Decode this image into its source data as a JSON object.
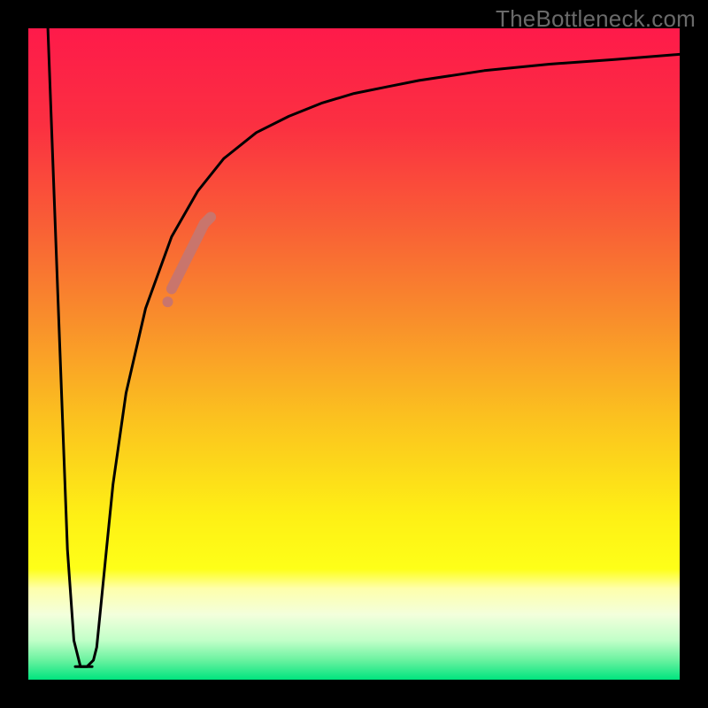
{
  "watermark": "TheBottleneck.com",
  "chart_data": {
    "type": "line",
    "title": "",
    "xlabel": "",
    "ylabel": "",
    "xlim": [
      0,
      100
    ],
    "ylim": [
      0,
      100
    ],
    "background_gradient": {
      "type": "vertical",
      "stops": [
        {
          "pos": 0.0,
          "color": "#fe1a4a"
        },
        {
          "pos": 0.15,
          "color": "#fb3041"
        },
        {
          "pos": 0.3,
          "color": "#f95e36"
        },
        {
          "pos": 0.45,
          "color": "#f98f2b"
        },
        {
          "pos": 0.6,
          "color": "#fbc21f"
        },
        {
          "pos": 0.75,
          "color": "#fef015"
        },
        {
          "pos": 0.83,
          "color": "#feff18"
        },
        {
          "pos": 0.86,
          "color": "#feffab"
        },
        {
          "pos": 0.9,
          "color": "#f3ffdc"
        },
        {
          "pos": 0.94,
          "color": "#c1ffc8"
        },
        {
          "pos": 0.97,
          "color": "#6af2a0"
        },
        {
          "pos": 1.0,
          "color": "#00e47e"
        }
      ]
    },
    "series": [
      {
        "name": "curve",
        "color": "#000000",
        "x": [
          3,
          4.5,
          6,
          7,
          8,
          9,
          10,
          10.5,
          11,
          12,
          13,
          15,
          18,
          22,
          26,
          30,
          35,
          40,
          45,
          50,
          55,
          60,
          70,
          80,
          90,
          100
        ],
        "y": [
          100,
          60,
          20,
          6,
          2,
          2,
          3,
          5,
          10,
          20,
          30,
          44,
          57,
          68,
          75,
          80,
          84,
          86.5,
          88.5,
          90,
          91,
          92,
          93.5,
          94.5,
          95.2,
          96
        ]
      },
      {
        "name": "highlight",
        "type": "scatter",
        "color": "#c9756c",
        "x": [
          22,
          23,
          24,
          25,
          26,
          27,
          28
        ],
        "y": [
          60,
          62,
          64,
          66,
          68,
          70,
          71
        ]
      }
    ]
  }
}
